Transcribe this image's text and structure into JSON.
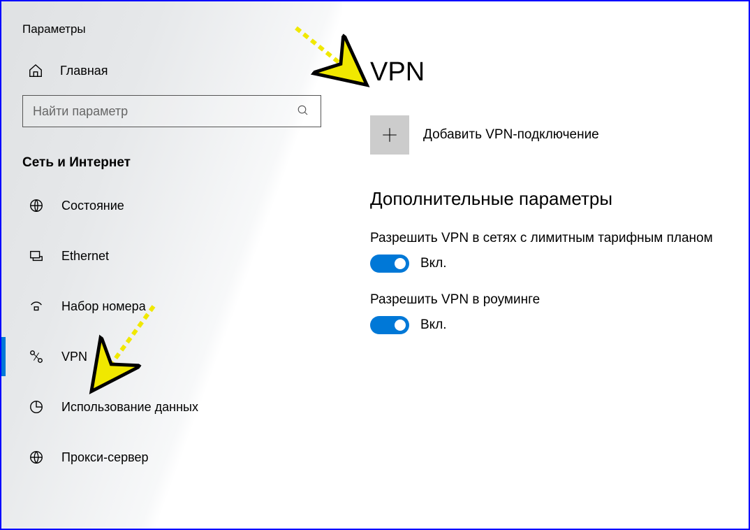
{
  "app_title": "Параметры",
  "home_label": "Главная",
  "search": {
    "placeholder": "Найти параметр"
  },
  "category_label": "Сеть и Интернет",
  "sidebar": {
    "items": [
      {
        "label": "Состояние",
        "icon": "globe-status-icon",
        "active": false
      },
      {
        "label": "Ethernet",
        "icon": "ethernet-icon",
        "active": false
      },
      {
        "label": "Набор номера",
        "icon": "dialup-icon",
        "active": false
      },
      {
        "label": "VPN",
        "icon": "vpn-icon",
        "active": true
      },
      {
        "label": "Использование данных",
        "icon": "data-usage-icon",
        "active": false
      },
      {
        "label": "Прокси-сервер",
        "icon": "proxy-icon",
        "active": false
      }
    ]
  },
  "main": {
    "title": "VPN",
    "add_label": "Добавить VPN-подключение",
    "section_title": "Дополнительные параметры",
    "settings": [
      {
        "label": "Разрешить VPN в сетях с лимитным тарифным планом",
        "state_label": "Вкл.",
        "on": true
      },
      {
        "label": "Разрешить VPN в роуминге",
        "state_label": "Вкл.",
        "on": true
      }
    ]
  },
  "colors": {
    "accent": "#0078d7",
    "annotation": "#f0e800"
  }
}
